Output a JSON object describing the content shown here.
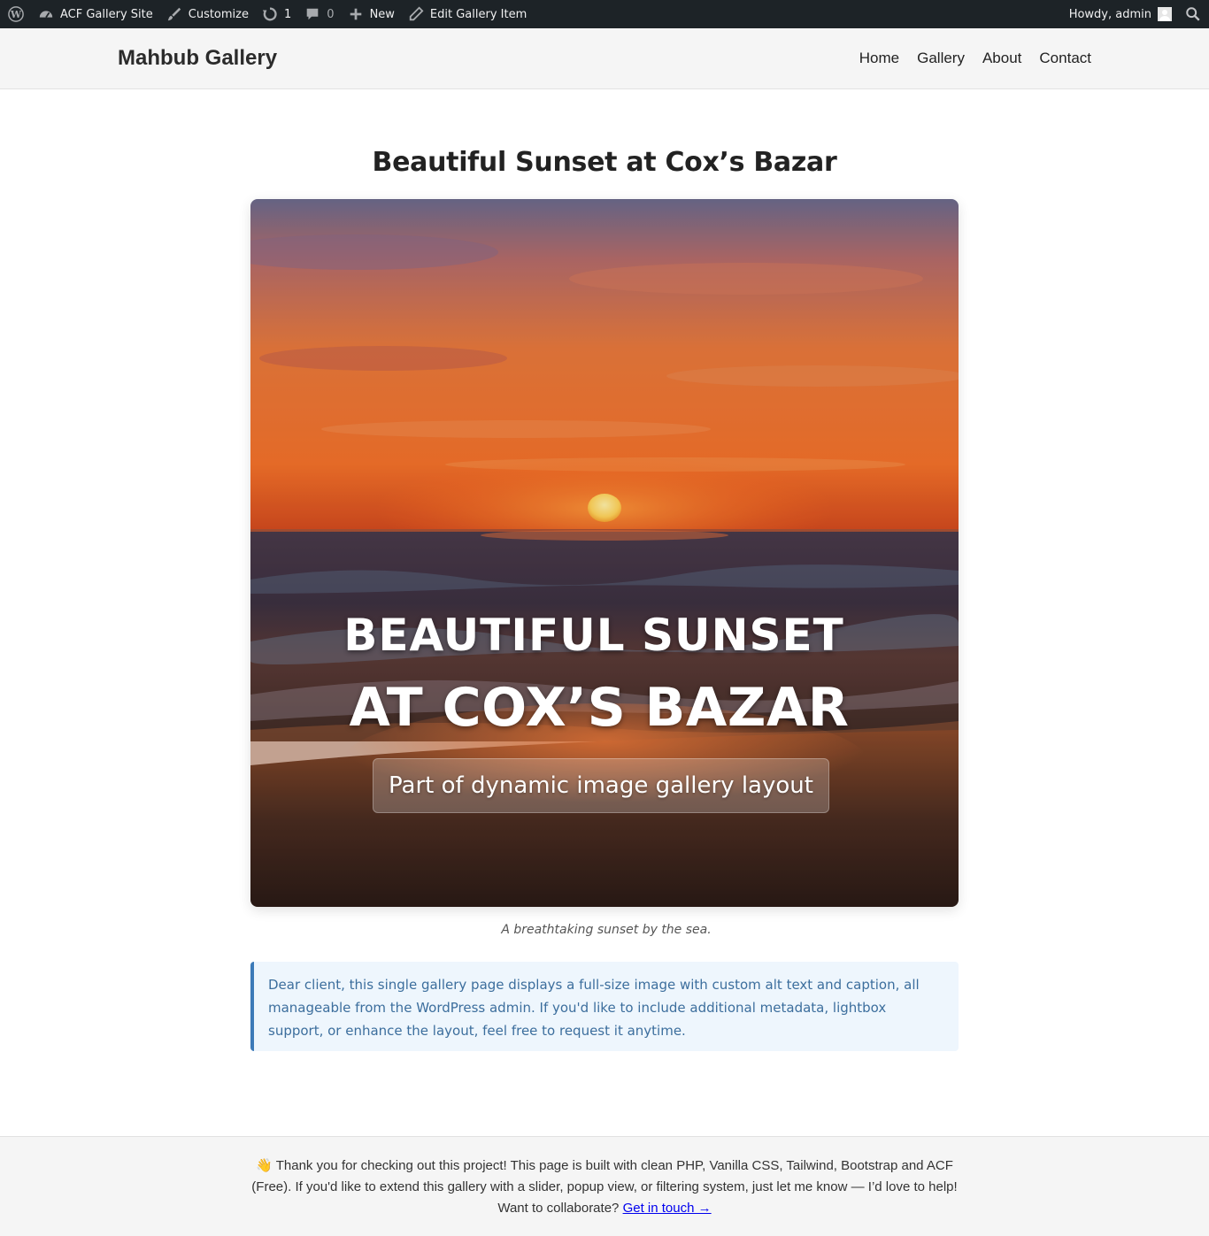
{
  "adminbar": {
    "site_name": "ACF Gallery Site",
    "customize": "Customize",
    "updates_count": "1",
    "comments_count": "0",
    "new": "New",
    "edit": "Edit Gallery Item",
    "greeting": "Howdy, admin",
    "bg_color": "#1d2327"
  },
  "header": {
    "site_title": "Mahbub Gallery",
    "nav": [
      "Home",
      "Gallery",
      "About",
      "Contact"
    ]
  },
  "post": {
    "title": "Beautiful Sunset at Cox’s Bazar",
    "image_text_line1": "BEAUTIFUL SUNSET",
    "image_text_line2": "AT COX’S BAZAR",
    "image_badge": "Part of dynamic image gallery layout",
    "caption": "A breathtaking sunset by the sea.",
    "note": "Dear client, this single gallery page displays a full-size image with custom alt text and caption, all manageable from the WordPress admin. If you'd like to include additional metadata, lightbox support, or enhance the layout, feel free to request it anytime."
  },
  "footer": {
    "emoji": "👋",
    "text": "Thank you for checking out this project! This page is built with clean PHP, Vanilla CSS, Tailwind, Bootstrap and ACF (Free). If you'd like to extend this gallery with a slider, popup view, or filtering system, just let me know — I’d love to help!",
    "cta_prefix": "Want to collaborate?",
    "cta_link": "Get in touch →"
  },
  "colors": {
    "note_border": "#3c7ab8",
    "note_bg": "#eef6fd",
    "link": "#0000ee"
  }
}
